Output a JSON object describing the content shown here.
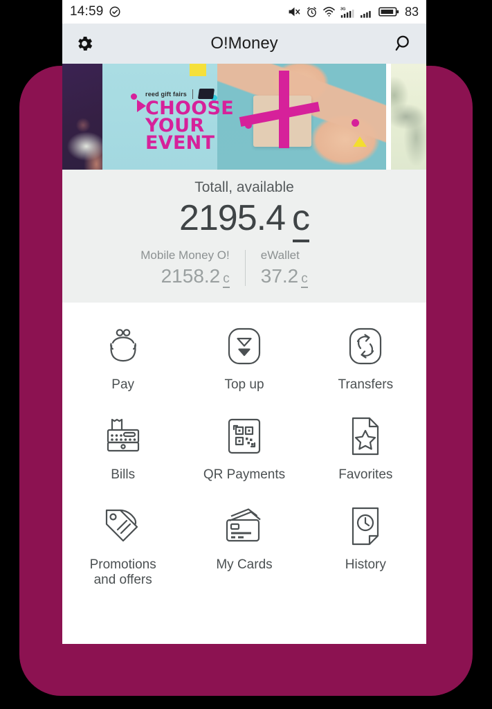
{
  "theme": {
    "shell_color": "#8c1251",
    "appbar_bg": "#e6eaee",
    "balance_bg": "#eef0ef",
    "accent_magenta": "#d6219a",
    "banner_bg": "#a7dbe2"
  },
  "status_bar": {
    "time": "14:59",
    "check_icon": "check-circle-icon",
    "icons": [
      "mute-speaker-icon",
      "alarm-clock-icon",
      "wifi-icon",
      "signal-3g-icon",
      "signal-bars-icon",
      "battery-icon"
    ],
    "battery_level": "83",
    "network_label": "3G"
  },
  "appbar": {
    "title": "O!Money",
    "settings_icon": "gear-icon",
    "search_icon": "search-icon"
  },
  "banner": {
    "brand": "reed gift fairs",
    "headline_line1": "CHOOSE",
    "headline_line2": "YOUR",
    "headline_line3": "EVENT"
  },
  "balance": {
    "caption": "Totall, available",
    "amount": "2195.4",
    "currency": "c",
    "accounts": [
      {
        "label": "Mobile Money O!",
        "amount": "2158.2",
        "currency": "c"
      },
      {
        "label": "eWallet",
        "amount": "37.2",
        "currency": "c"
      }
    ]
  },
  "actions": [
    {
      "label": "Pay",
      "icon": "coin-purse-icon"
    },
    {
      "label": "Top up",
      "icon": "top-up-icon"
    },
    {
      "label": "Transfers",
      "icon": "transfers-icon"
    },
    {
      "label": "Bills",
      "icon": "cash-register-icon"
    },
    {
      "label": "QR Payments",
      "icon": "qr-code-icon"
    },
    {
      "label": "Favorites",
      "icon": "document-star-icon"
    },
    {
      "label": "Promotions\nand offers",
      "icon": "price-tags-icon"
    },
    {
      "label": "My Cards",
      "icon": "credit-cards-icon"
    },
    {
      "label": "History",
      "icon": "document-clock-icon"
    }
  ]
}
